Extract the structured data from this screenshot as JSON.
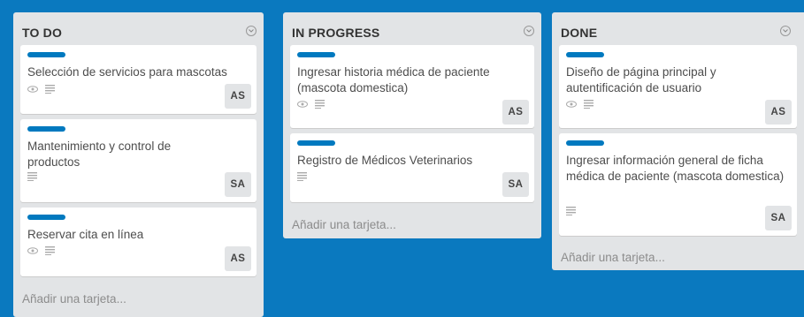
{
  "board": {
    "background": "#0a79bf",
    "label_color": "#0079bf"
  },
  "lists": [
    {
      "title": "TO DO",
      "add_card": "Añadir una tarjeta...",
      "cards": [
        {
          "title": "Selección de servicios para mascotas",
          "has_eye": true,
          "member": "AS"
        },
        {
          "title": "Mantenimiento y control de productos",
          "has_eye": false,
          "member": "SA"
        },
        {
          "title": "Reservar cita en línea",
          "has_eye": true,
          "member": "AS"
        }
      ]
    },
    {
      "title": "IN PROGRESS",
      "add_card": "Añadir una tarjeta...",
      "cards": [
        {
          "title": "Ingresar historia médica de paciente (mascota domestica)",
          "has_eye": true,
          "member": "AS"
        },
        {
          "title": "Registro de Médicos Veterinarios",
          "has_eye": false,
          "member": "SA"
        }
      ]
    },
    {
      "title": "DONE",
      "add_card": "Añadir una tarjeta...",
      "cards": [
        {
          "title": "Diseño de página principal y autentificación de usuario",
          "has_eye": true,
          "member": "AS"
        },
        {
          "title": "Ingresar información general de ficha médica de paciente (mascota domestica)",
          "has_eye": false,
          "member": "SA"
        }
      ]
    }
  ]
}
